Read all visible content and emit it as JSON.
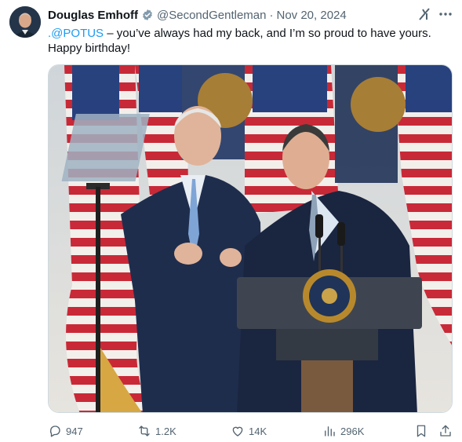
{
  "post": {
    "author_name": "Douglas Emhoff",
    "handle": "@SecondGentleman",
    "separator": "·",
    "date": "Nov 20, 2024",
    "mention": ".@POTUS",
    "text_after_mention": " – you’ve always had my back, and I’m so proud to have yours.",
    "text_line2": "Happy birthday!"
  },
  "actions": {
    "replies": "947",
    "reposts": "1.2K",
    "likes": "14K",
    "views": "296K"
  },
  "icons": {
    "verified": "verified-badge-icon",
    "grok": "grok-icon",
    "more": "more-icon",
    "reply": "reply-icon",
    "repost": "repost-icon",
    "like": "heart-icon",
    "views": "views-icon",
    "bookmark": "bookmark-icon",
    "share": "share-icon"
  },
  "colors": {
    "accent": "#1d9bf0",
    "secondary_text": "#536471",
    "primary_text": "#0f1419"
  }
}
